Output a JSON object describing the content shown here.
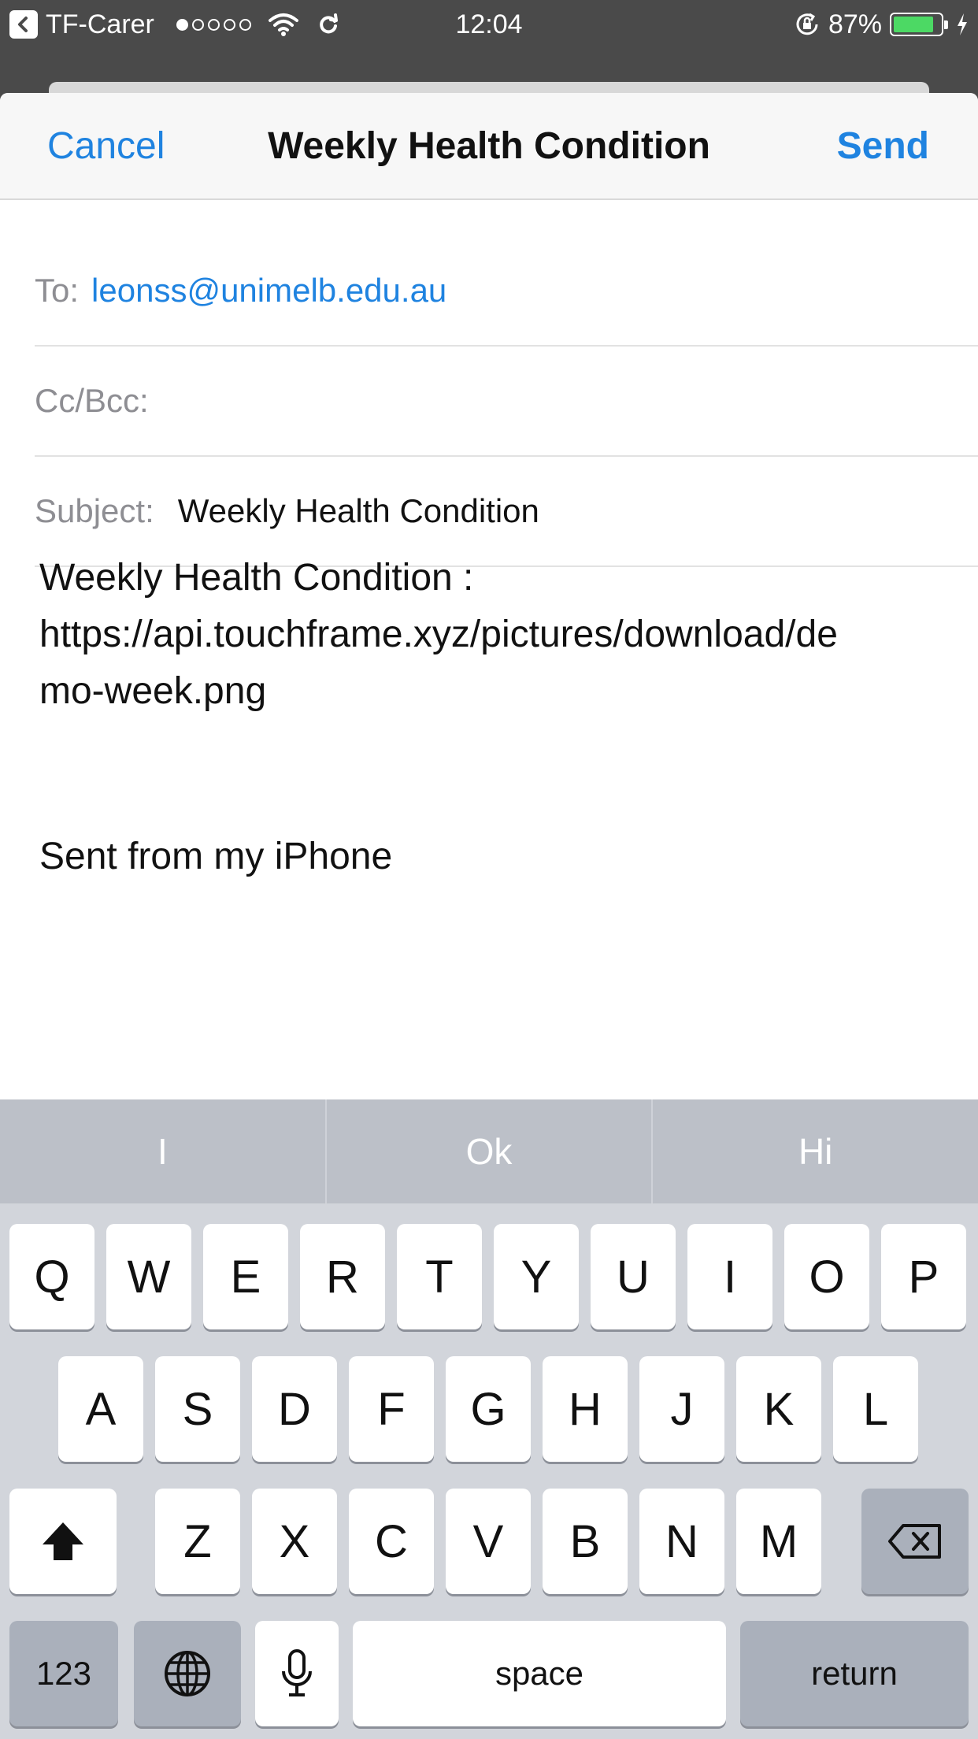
{
  "status_bar": {
    "back_app": "TF-Carer",
    "time": "12:04",
    "battery_percent": "87%",
    "battery_level": 0.87,
    "icons": [
      "back-arrow-icon",
      "signal-dots-icon",
      "wifi-icon",
      "sync-icon",
      "orientation-lock-icon",
      "battery-icon",
      "charging-icon"
    ]
  },
  "compose": {
    "cancel_label": "Cancel",
    "title": "Weekly Health Condition",
    "send_label": "Send",
    "to_label": "To:",
    "to_value": "leonss@unimelb.edu.au",
    "cc_label": "Cc/Bcc:",
    "subject_label": "Subject:",
    "subject_value": "Weekly Health Condition",
    "body_lines": [
      "Weekly Health Condition :",
      "https://api.touchframe.xyz/pictures/download/de",
      "mo-week.png"
    ],
    "signature": "Sent from my iPhone",
    "accent_color": "#1f83e0"
  },
  "keyboard": {
    "predictions": [
      "I",
      "Ok",
      "Hi"
    ],
    "row1": [
      "Q",
      "W",
      "E",
      "R",
      "T",
      "Y",
      "U",
      "I",
      "O",
      "P"
    ],
    "row2": [
      "A",
      "S",
      "D",
      "F",
      "G",
      "H",
      "J",
      "K",
      "L"
    ],
    "row3": [
      "Z",
      "X",
      "C",
      "V",
      "B",
      "N",
      "M"
    ],
    "numbers_label": "123",
    "space_label": "space",
    "return_label": "return"
  }
}
